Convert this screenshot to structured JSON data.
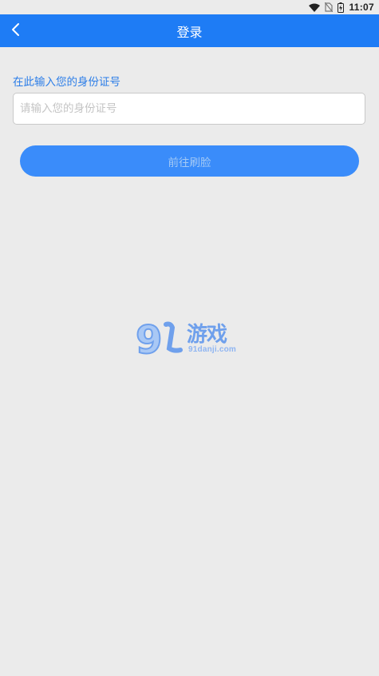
{
  "status_bar": {
    "time": "11:07",
    "icons": [
      "wifi-icon",
      "no-sim-icon",
      "battery-charging-icon"
    ]
  },
  "app_bar": {
    "title": "登录",
    "back_icon": "chevron-left-icon"
  },
  "form": {
    "label": "在此输入您的身份证号",
    "input_placeholder": "请输入您的身份证号",
    "input_value": "",
    "submit_label": "前往刷脸"
  },
  "watermark": {
    "number": "9",
    "name": "游戏",
    "domain": "91danji.com"
  },
  "colors": {
    "primary": "#1e7cf5",
    "button": "#3a8cfa",
    "label": "#2b7de8",
    "background": "#ebebeb"
  }
}
